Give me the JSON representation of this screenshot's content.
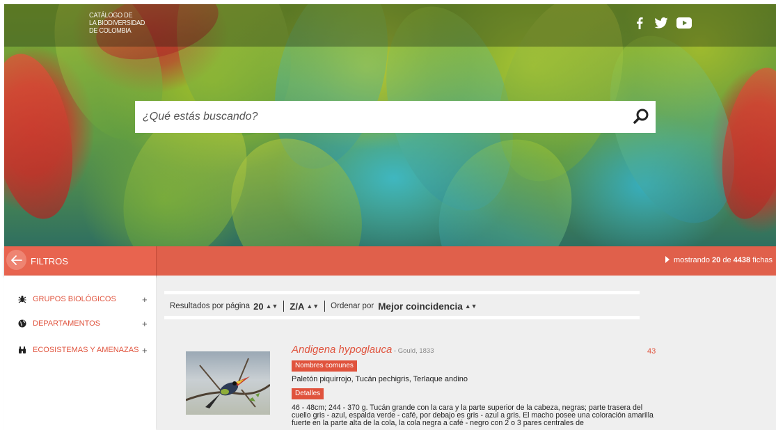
{
  "header": {
    "logo_lines": [
      "CATÁLOGO DE",
      "LA BIODIVERSIDAD",
      "DE COLOMBIA"
    ],
    "social": [
      "facebook-icon",
      "twitter-icon",
      "youtube-icon"
    ]
  },
  "search": {
    "placeholder": "¿Qué estás buscando?"
  },
  "filters": {
    "label": "FILTROS",
    "items": [
      {
        "icon": "bug-icon",
        "label": "GRUPOS BIOLÓGICOS",
        "expand": "+"
      },
      {
        "icon": "globe-icon",
        "label": "DEPARTAMENTOS",
        "expand": "+"
      },
      {
        "icon": "binoculars-icon",
        "label": "ECOSISTEMAS Y AMENAZAS",
        "expand": "+"
      }
    ]
  },
  "results_info": {
    "prefix": "mostrando",
    "shown": "20",
    "middle": "de",
    "total": "4438",
    "suffix": "fichas"
  },
  "controls": {
    "per_page_label": "Resultados por página",
    "per_page_value": "20",
    "sort_dir": "Z/A",
    "order_label": "Ordenar por",
    "order_value": "Mejor coincidencia"
  },
  "results": [
    {
      "species": "Andigena hypoglauca",
      "author": " - Gould, 1833",
      "count": "43",
      "common_tag": "Nombres comunes",
      "common_names": "Paletón piquirrojo, Tucán pechigris, Terlaque andino",
      "details_tag": "Detalles",
      "details": "46 - 48cm; 244 - 370 g. Tucán grande con la cara y la parte superior de la cabeza, negras; parte trasera del cuello gris - azul, espalda verde - café, por debajo es gris - azul a gris. El macho posee una coloración amarilla fuerte en la parte alta de la cola, la cola negra a café - negro con 2 o 3 pares centrales de"
    }
  ],
  "colors": {
    "accent": "#e0533d",
    "bar": "#e0604b",
    "panel_bg": "#efefef"
  }
}
